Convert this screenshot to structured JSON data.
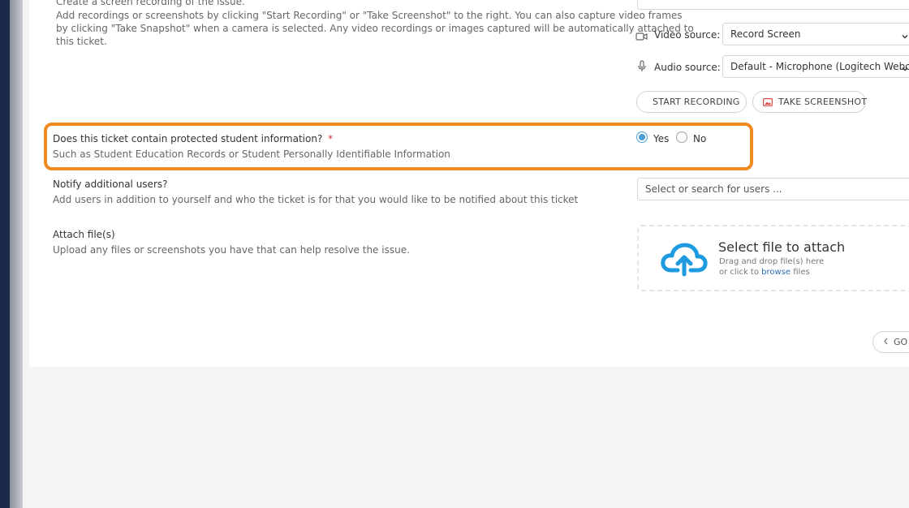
{
  "recording": {
    "intro_line": "Create a screen recording of the issue.",
    "description_1": "Add recordings or screenshots by clicking \"Start Recording\" or \"Take Screenshot\" to the right.  You can also capture video frames",
    "description_2": "by clicking \"Take Snapshot\" when a camera is selected.  Any video recordings or images captured will be automatically attached to",
    "description_3": "this ticket.",
    "video_source_label": "Video source:",
    "video_source_value": "Record Screen",
    "audio_source_label": "Audio source:",
    "audio_source_value": "Default - Microphone (Logitech Webcam",
    "start_recording_label": "START RECORDING",
    "take_screenshot_label": "TAKE SCREENSHOT"
  },
  "protected_info": {
    "question": "Does this ticket contain protected student information?",
    "required_mark": "*",
    "hint": "Such as Student Education Records or Student Personally Identifiable Information",
    "option_yes": "Yes",
    "option_no": "No",
    "selected": "Yes"
  },
  "notify": {
    "label": "Notify additional users?",
    "hint": "Add users in addition to yourself and who the ticket is for that you would like to be notified about this ticket",
    "placeholder": "Select or search for users ..."
  },
  "attach": {
    "label": "Attach file(s)",
    "hint": "Upload any files or screenshots you have that can help resolve the issue.",
    "dropzone_title": "Select file to attach",
    "dropzone_line1": "Drag and drop file(s) here",
    "dropzone_line2_prefix": "or click to ",
    "dropzone_link": "browse",
    "dropzone_line2_suffix": " files"
  },
  "footer": {
    "go_label": "GO"
  },
  "colors": {
    "highlight": "#ef8a23",
    "radio_on": "#4a9fd8",
    "link": "#2d6db5",
    "required": "#c0392b",
    "record_dot": "#f19a9a",
    "screenshot_icon": "#d9534f"
  }
}
